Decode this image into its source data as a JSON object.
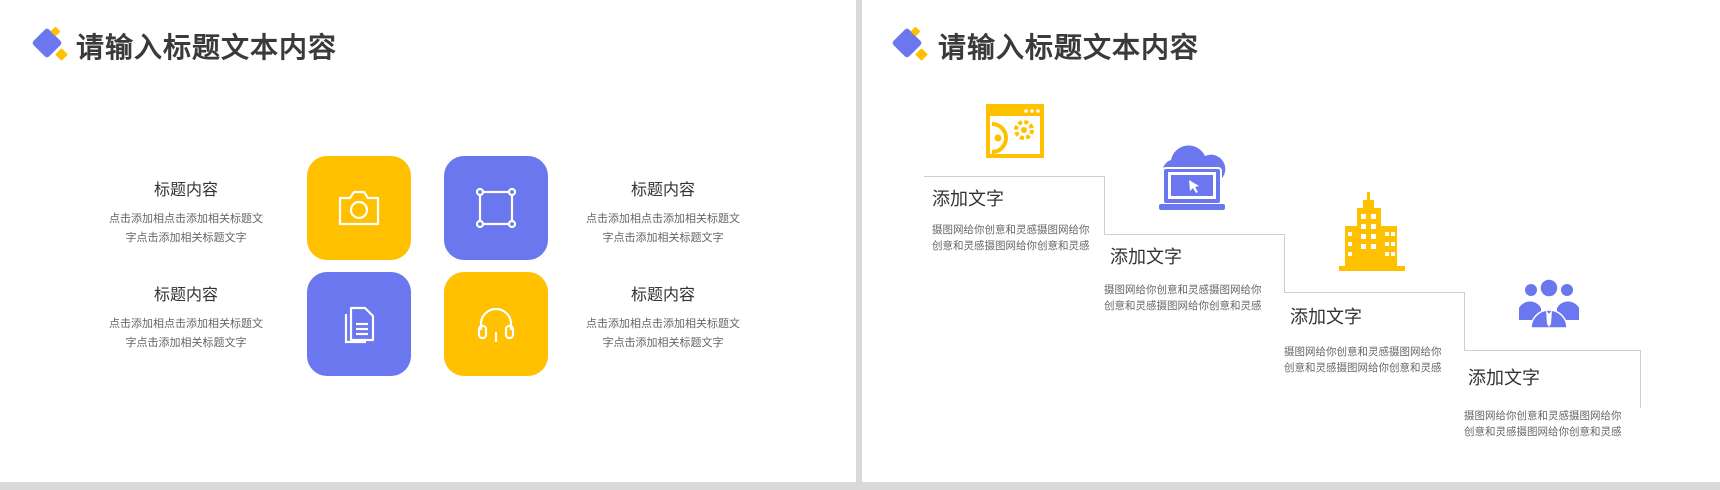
{
  "left_slide": {
    "title": "请输入标题文本内容",
    "blocks": [
      {
        "heading": "标题内容",
        "desc_line1": "点击添加相点击添加相关标题文",
        "desc_line2": "字点击添加相关标题文字"
      },
      {
        "heading": "标题内容",
        "desc_line1": "点击添加相点击添加相关标题文",
        "desc_line2": "字点击添加相关标题文字"
      },
      {
        "heading": "标题内容",
        "desc_line1": "点击添加相点击添加相关标题文",
        "desc_line2": "字点击添加相关标题文字"
      },
      {
        "heading": "标题内容",
        "desc_line1": "点击添加相点击添加相关标题文",
        "desc_line2": "字点击添加相关标题文字"
      }
    ],
    "tiles": [
      {
        "icon": "camera-icon",
        "color": "#ffc000"
      },
      {
        "icon": "crop-frame-icon",
        "color": "#6b77ee"
      },
      {
        "icon": "document-icon",
        "color": "#6b77ee"
      },
      {
        "icon": "headphones-icon",
        "color": "#ffc000"
      }
    ]
  },
  "right_slide": {
    "title": "请输入标题文本内容",
    "steps": [
      {
        "heading": "添加文字",
        "desc_line1": "摄图网给你创意和灵感摄图网给你",
        "desc_line2": "创意和灵感摄图网给你创意和灵感",
        "icon": "settings-window-icon",
        "color": "#ffc000"
      },
      {
        "heading": "添加文字",
        "desc_line1": "摄图网给你创意和灵感摄图网给你",
        "desc_line2": "创意和灵感摄图网给你创意和灵感",
        "icon": "cloud-computer-icon",
        "color": "#6b77ee"
      },
      {
        "heading": "添加文字",
        "desc_line1": "摄图网给你创意和灵感摄图网给你",
        "desc_line2": "创意和灵感摄图网给你创意和灵感",
        "icon": "building-icon",
        "color": "#ffc000"
      },
      {
        "heading": "添加文字",
        "desc_line1": "摄图网给你创意和灵感摄图网给你",
        "desc_line2": "创意和灵感摄图网给你创意和灵感",
        "icon": "team-icon",
        "color": "#6b77ee"
      }
    ]
  },
  "colors": {
    "accent_blue": "#6b77ee",
    "accent_yellow": "#ffc000"
  }
}
